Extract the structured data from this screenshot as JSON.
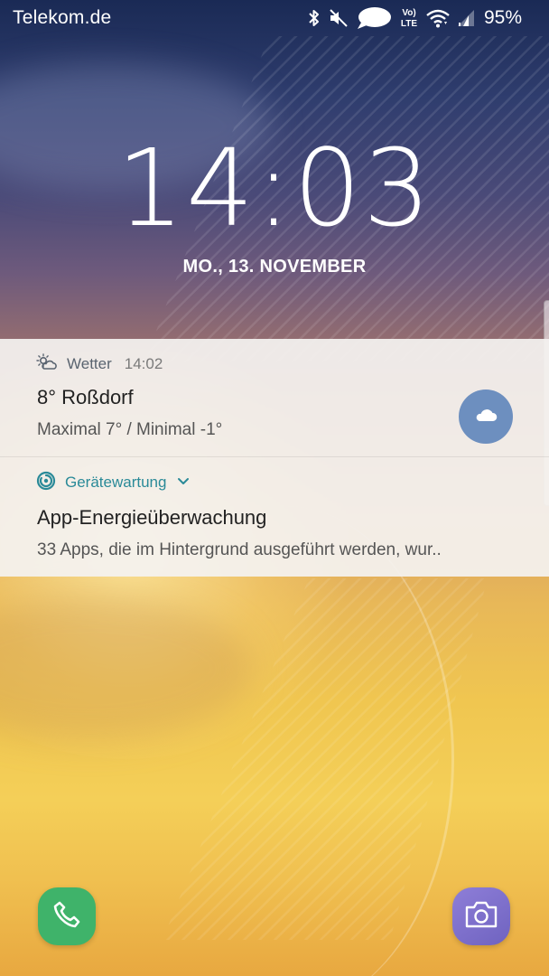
{
  "status_bar": {
    "carrier": "Telekom.de",
    "network_label_top": "Vo)",
    "network_label_bottom": "LTE",
    "battery_percent": "95%",
    "battery_level": 0.95,
    "icons": [
      "bluetooth-icon",
      "mute-icon",
      "chat-bubble-icon",
      "volte-icon",
      "wifi-icon",
      "signal-icon"
    ]
  },
  "lockscreen": {
    "clock": "14:03",
    "date": "MO., 13. NOVEMBER"
  },
  "notifications": [
    {
      "app_name": "Wetter",
      "time": "14:02",
      "title": "8° Roßdorf",
      "text": "Maximal 7° / Minimal -1°",
      "icon": "weather-icon",
      "badge_icon": "cloud-icon",
      "app_color": "#5a6470",
      "badge_color": "#6d8fbf"
    },
    {
      "app_name": "Gerätewartung",
      "title": "App-Energieüberwachung",
      "text": "33 Apps, die im Hintergrund ausgeführt werden, wur..",
      "icon": "device-maintenance-icon",
      "expand_icon": "chevron-down-icon",
      "app_color": "#2a8a98"
    }
  ],
  "shortcuts": {
    "left": {
      "icon": "phone-icon",
      "color": "#3fb36a"
    },
    "right": {
      "icon": "camera-icon",
      "color": "#7a6cd0"
    }
  }
}
